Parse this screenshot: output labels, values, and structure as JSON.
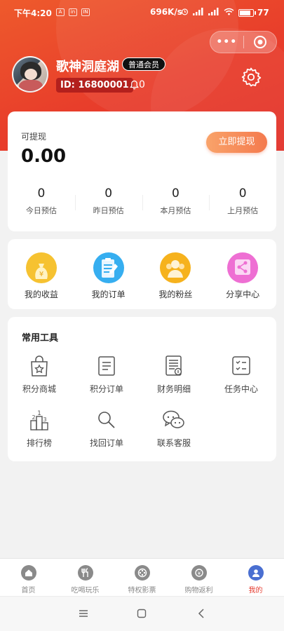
{
  "status_bar": {
    "time": "下午4:20",
    "mini_icons": [
      "A",
      "in",
      "IN"
    ],
    "network_speed": "696K/s",
    "battery_level": 0.77,
    "battery_text": "77"
  },
  "capsule": {
    "more_label": "•••",
    "icons": [
      "more-icon",
      "target-icon"
    ]
  },
  "profile": {
    "username": "歌神洞庭湖",
    "member_level": "普通会员",
    "id_label": "ID: 16800001",
    "notification_count": "0"
  },
  "balance": {
    "label": "可提现",
    "value": "0.00",
    "withdraw_label": "立即提现",
    "stats": [
      {
        "value": "0",
        "label": "今日预估"
      },
      {
        "value": "0",
        "label": "昨日预估"
      },
      {
        "value": "0",
        "label": "本月预估"
      },
      {
        "value": "0",
        "label": "上月预估"
      }
    ]
  },
  "shortcuts": [
    {
      "label": "我的收益",
      "icon": "money-bag-icon",
      "color": "#f6c231"
    },
    {
      "label": "我的订单",
      "icon": "order-list-icon",
      "color": "#36aef0"
    },
    {
      "label": "我的粉丝",
      "icon": "fans-icon",
      "color": "#f6b21d"
    },
    {
      "label": "分享中心",
      "icon": "share-icon",
      "color": "#ee6fd3"
    }
  ],
  "tools": {
    "title": "常用工具",
    "items": [
      {
        "label": "积分商城",
        "icon": "points-mall-icon"
      },
      {
        "label": "积分订单",
        "icon": "points-order-icon"
      },
      {
        "label": "财务明细",
        "icon": "finance-detail-icon"
      },
      {
        "label": "任务中心",
        "icon": "task-center-icon"
      },
      {
        "label": "排行榜",
        "icon": "ranking-icon"
      },
      {
        "label": "找回订单",
        "icon": "search-order-icon"
      },
      {
        "label": "联系客服",
        "icon": "customer-service-icon"
      }
    ]
  },
  "tabbar": {
    "active_color": "#e53b2f",
    "items": [
      {
        "label": "首页",
        "icon": "home-icon"
      },
      {
        "label": "吃喝玩乐",
        "icon": "food-icon"
      },
      {
        "label": "特权影票",
        "icon": "film-icon"
      },
      {
        "label": "购物返利",
        "icon": "shopping-icon"
      },
      {
        "label": "我的",
        "icon": "profile-icon",
        "active": true
      }
    ]
  },
  "navbar": {
    "icons": [
      "menu-icon",
      "home-square-icon",
      "back-icon"
    ]
  }
}
